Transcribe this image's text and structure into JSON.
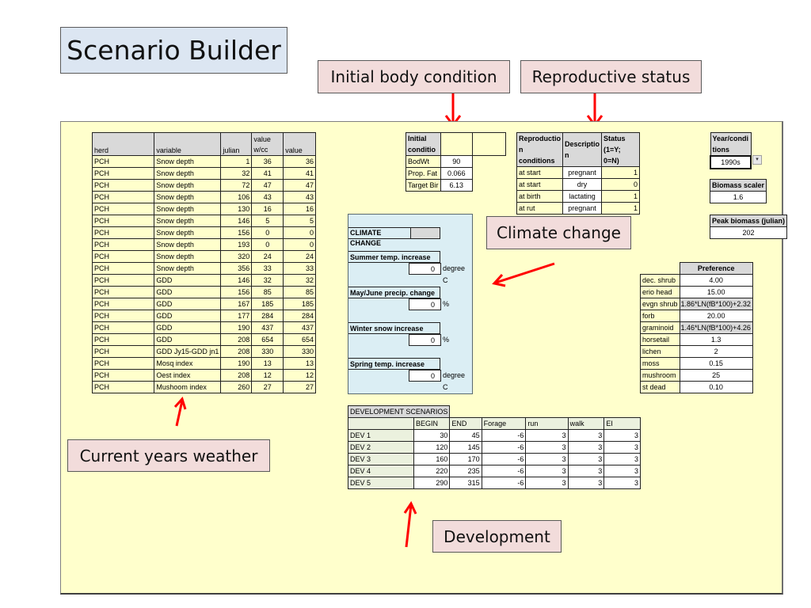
{
  "title": "Scenario Builder",
  "callouts": {
    "initial_body_condition": "Initial body condition",
    "reproductive_status": "Reproductive status",
    "climate_change": "Climate change",
    "current_years_weather": "Current years weather",
    "development": "Development"
  },
  "weather_table": {
    "headers": [
      "herd",
      "variable",
      "julian",
      "value w/cc",
      "value"
    ],
    "header_value_cc_line1": "value",
    "header_value_cc_line2": "w/cc",
    "rows": [
      [
        "PCH",
        "Snow depth",
        "1",
        "36",
        "36"
      ],
      [
        "PCH",
        "Snow depth",
        "32",
        "41",
        "41"
      ],
      [
        "PCH",
        "Snow depth",
        "72",
        "47",
        "47"
      ],
      [
        "PCH",
        "Snow depth",
        "106",
        "43",
        "43"
      ],
      [
        "PCH",
        "Snow depth",
        "130",
        "16",
        "16"
      ],
      [
        "PCH",
        "Snow depth",
        "146",
        "5",
        "5"
      ],
      [
        "PCH",
        "Snow depth",
        "156",
        "0",
        "0"
      ],
      [
        "PCH",
        "Snow depth",
        "193",
        "0",
        "0"
      ],
      [
        "PCH",
        "Snow depth",
        "320",
        "24",
        "24"
      ],
      [
        "PCH",
        "Snow depth",
        "356",
        "33",
        "33"
      ],
      [
        "PCH",
        "GDD",
        "146",
        "32",
        "32"
      ],
      [
        "PCH",
        "GDD",
        "156",
        "85",
        "85"
      ],
      [
        "PCH",
        "GDD",
        "167",
        "185",
        "185"
      ],
      [
        "PCH",
        "GDD",
        "177",
        "284",
        "284"
      ],
      [
        "PCH",
        "GDD",
        "190",
        "437",
        "437"
      ],
      [
        "PCH",
        "GDD",
        "208",
        "654",
        "654"
      ],
      [
        "PCH",
        "GDD Jy15-GDD jn1",
        "208",
        "330",
        "330"
      ],
      [
        "PCH",
        "Mosq index",
        "190",
        "13",
        "13"
      ],
      [
        "PCH",
        "Oest index",
        "208",
        "12",
        "12"
      ],
      [
        "PCH",
        "Mushoom index",
        "260",
        "27",
        "27"
      ]
    ]
  },
  "initial_condition": {
    "header_line1": "Initial",
    "header_line2": "conditio",
    "rows": [
      {
        "label": "BodWt",
        "value": "90"
      },
      {
        "label": "Prop. Fat",
        "value": "0.066"
      },
      {
        "label": "Target Bir",
        "value": "6.13"
      }
    ]
  },
  "reproduction": {
    "headers": [
      {
        "line1": "Reproductio",
        "line2": "n conditions"
      },
      {
        "line1": "Descriptio",
        "line2": "n"
      },
      {
        "line1": "Status",
        "line2": "(1=Y; 0=N)"
      }
    ],
    "rows": [
      {
        "condition": "at start",
        "description": "pregnant",
        "status": "1"
      },
      {
        "condition": "at start",
        "description": "dry",
        "status": "0"
      },
      {
        "condition": "at birth",
        "description": "lactating",
        "status": "1"
      },
      {
        "condition": "at rut",
        "description": "pregnant",
        "status": "1"
      }
    ]
  },
  "year_conditions": {
    "label_line1": "Year/condi",
    "label_line2": "tions",
    "selected": "1990s",
    "dropdown_glyph": "▾"
  },
  "biomass_scaler": {
    "label": "Biomass scaler",
    "value": "1.6"
  },
  "peak_biomass": {
    "label": "Peak biomass (julian)",
    "value": "202"
  },
  "preference": {
    "header": "Preference",
    "rows": [
      {
        "item": "dec. shrub",
        "value": "4.00"
      },
      {
        "item": "erio head",
        "value": "15.00"
      },
      {
        "item": "evgn shrub",
        "value": "1.86*LN(fB*100)+2.32"
      },
      {
        "item": "forb",
        "value": "20.00"
      },
      {
        "item": "graminoid",
        "value": "1.46*LN(fB*100)+4.26"
      },
      {
        "item": "horsetail",
        "value": "1.3"
      },
      {
        "item": "lichen",
        "value": "2"
      },
      {
        "item": "moss",
        "value": "0.15"
      },
      {
        "item": "mushroom",
        "value": "25"
      },
      {
        "item": "st dead",
        "value": "0.10"
      }
    ]
  },
  "climate_change": {
    "header": "CLIMATE CHANGE",
    "fields": [
      {
        "label": "Summer temp. increase",
        "value": "0",
        "unit": "degree C"
      },
      {
        "label": "May/June precip. change",
        "value": "0",
        "unit": "%"
      },
      {
        "label": "Winter snow increase",
        "value": "0",
        "unit": "%"
      },
      {
        "label": "Spring temp. increase",
        "value": "0",
        "unit": "degree C"
      }
    ]
  },
  "development": {
    "title": "DEVELOPMENT SCENARIOS",
    "headers": [
      "",
      "BEGIN",
      "END",
      "Forage",
      "run",
      "walk",
      "EI"
    ],
    "rows": [
      [
        "DEV 1",
        "30",
        "45",
        "-6",
        "3",
        "3",
        "3"
      ],
      [
        "DEV 2",
        "120",
        "145",
        "-6",
        "3",
        "3",
        "3"
      ],
      [
        "DEV 3",
        "160",
        "170",
        "-6",
        "3",
        "3",
        "3"
      ],
      [
        "DEV 4",
        "220",
        "235",
        "-6",
        "3",
        "3",
        "3"
      ],
      [
        "DEV 5",
        "290",
        "315",
        "-6",
        "3",
        "3",
        "3"
      ]
    ]
  },
  "colors": {
    "panel_bg": "#ffffcc",
    "title_bg": "#dce6f2",
    "callout_bg": "#f2dcdb",
    "climate_bg": "#dbeef4",
    "dev_label_bg": "#ebf1de",
    "header_bg": "#d9d9d9",
    "arrow": "#ff0000"
  }
}
